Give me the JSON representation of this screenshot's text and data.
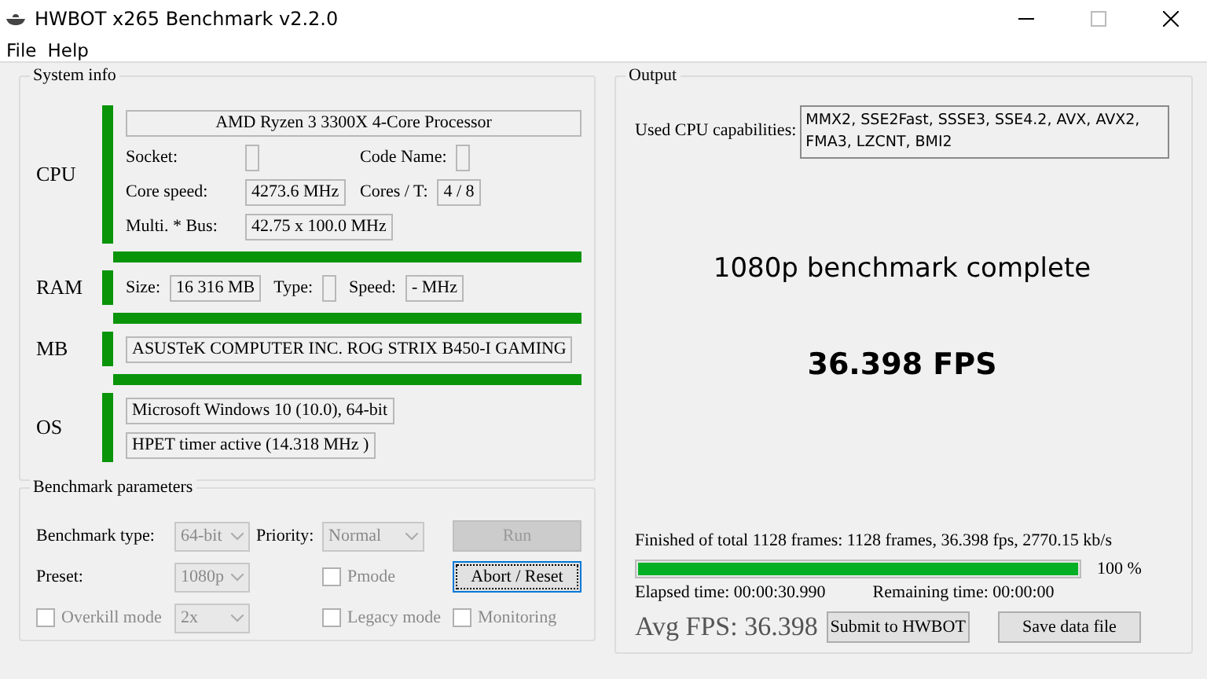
{
  "window": {
    "title": "HWBOT x265 Benchmark v2.2.0"
  },
  "menu": [
    "File",
    "Help"
  ],
  "system_info": {
    "title": "System info",
    "sections": [
      {
        "label": "CPU",
        "rows": [
          [
            {
              "kind": "wide",
              "value": "AMD Ryzen 3 3300X 4-Core Processor"
            }
          ],
          [
            {
              "kind": "field",
              "label": "Socket:"
            },
            {
              "kind": "field",
              "label": "Code Name:"
            }
          ],
          [
            {
              "kind": "field",
              "label": "Core speed:",
              "value": "4273.6 MHz"
            },
            {
              "kind": "field",
              "label": "Cores / T:",
              "value": "4 / 8"
            }
          ],
          [
            {
              "kind": "field",
              "label": "Multi. * Bus:",
              "value": "42.75 x 100.0 MHz"
            }
          ]
        ]
      },
      {
        "label": "RAM",
        "rows": [
          [
            {
              "kind": "field",
              "label": "Size:",
              "value": "16 316 MB"
            },
            {
              "kind": "field",
              "label": "Type:"
            },
            {
              "kind": "field",
              "label": "Speed:",
              "value": "- MHz"
            }
          ]
        ]
      },
      {
        "label": "MB",
        "rows": [
          [
            {
              "kind": "text",
              "value": "ASUSTeK COMPUTER INC. ROG STRIX B450-I GAMING"
            }
          ]
        ]
      },
      {
        "label": "OS",
        "rows": [
          [
            {
              "kind": "text",
              "value": "Microsoft Windows 10 (10.0), 64-bit"
            }
          ],
          [
            {
              "kind": "text",
              "value": "HPET timer active (14.318 MHz )"
            }
          ]
        ]
      }
    ]
  },
  "benchmark_parameters": {
    "title": "Benchmark parameters",
    "rows": [
      [
        {
          "kind": "label",
          "text": "Benchmark type:"
        },
        {
          "kind": "select",
          "value": "64-bit",
          "disabled": true
        },
        {
          "kind": "label",
          "text": "Priority:"
        },
        {
          "kind": "select",
          "value": "Normal",
          "disabled": true
        },
        {
          "kind": "button",
          "label": "Run",
          "disabled": true,
          "focused": false
        }
      ],
      [
        {
          "kind": "label",
          "text": "Preset:"
        },
        {
          "kind": "select",
          "value": "1080p",
          "disabled": true
        },
        "",
        {
          "kind": "checkbox",
          "label": "Pmode",
          "checked": false,
          "disabled": true
        },
        {
          "kind": "button",
          "label": "Abort / Reset",
          "disabled": false,
          "focused": true
        }
      ],
      [
        {
          "kind": "checkbox",
          "label": "Overkill mode",
          "checked": false,
          "disabled": true
        },
        {
          "kind": "select",
          "value": "2x",
          "disabled": true
        },
        "",
        {
          "kind": "checkbox",
          "label": "Legacy mode",
          "checked": false,
          "disabled": true
        },
        {
          "kind": "checkbox",
          "label": "Monitoring",
          "checked": false,
          "disabled": true
        }
      ]
    ]
  },
  "output": {
    "title": "Output",
    "capabilities_label": "Used CPU capabilities:",
    "capabilities": "MMX2, SSE2Fast, SSSE3, SSE4.2, AVX, AVX2, FMA3, LZCNT, BMI2",
    "status": "1080p benchmark complete",
    "result": "36.398 FPS",
    "progress_text": "Finished of total 1128 frames: 1128 frames, 36.398 fps,  2770.15 kb/s",
    "progress": {
      "level": 1.0,
      "percent": "100 %"
    },
    "elapsed": "Elapsed time: 00:00:30.990",
    "remaining": "Remaining time: 00:00:00",
    "avg_fps": "Avg FPS: 36.398",
    "buttons": [
      "Submit to HWBOT",
      "Save data file"
    ]
  }
}
